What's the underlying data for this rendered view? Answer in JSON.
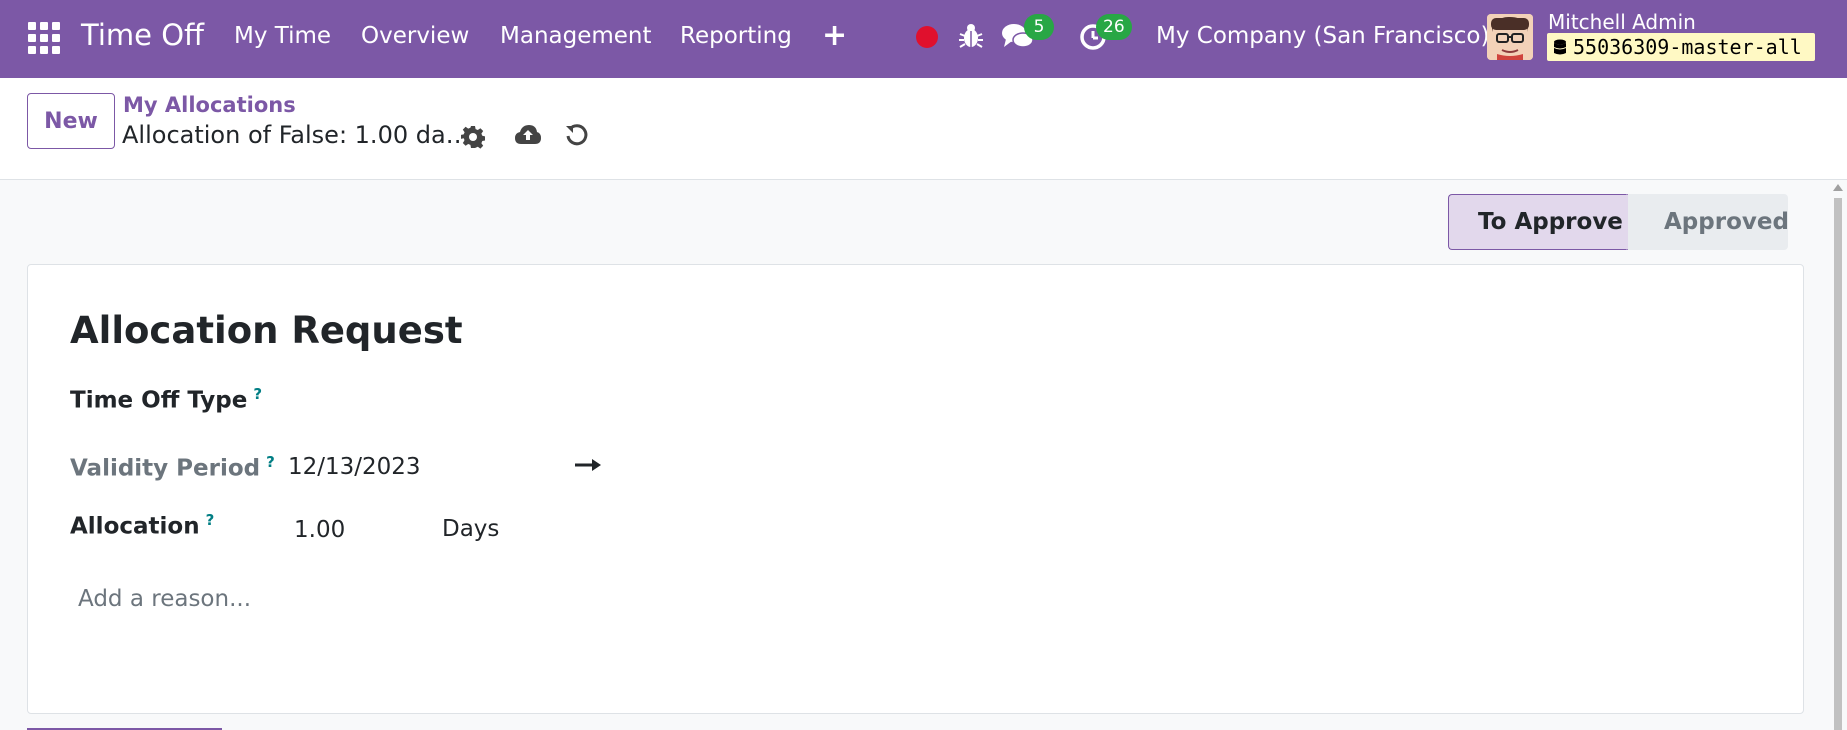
{
  "navbar": {
    "brand": "Time Off",
    "menu": [
      "My Time",
      "Overview",
      "Management",
      "Reporting"
    ],
    "plus": "+",
    "chat_count": "5",
    "activity_count": "26",
    "company": "My Company (San Francisco)",
    "user_name": "Mitchell Admin",
    "database": "55036309-master-all",
    "accent_color": "#7c58a6",
    "badge_color": "#28a745",
    "record_dot_color": "#e0102d"
  },
  "control_panel": {
    "new_label": "New",
    "breadcrumb": "My Allocations",
    "record_title": "Allocation of False: 1.00 da…",
    "icons": [
      "gear-icon",
      "cloud-upload-icon",
      "discard-icon"
    ]
  },
  "statusbar": {
    "stages": [
      "To Approve",
      "Approved"
    ],
    "active_stage": "To Approve"
  },
  "form": {
    "title": "Allocation Request",
    "time_off_type_label": "Time Off Type",
    "validity_label": "Validity Period",
    "validity_start": "12/13/2023",
    "validity_end": "",
    "allocation_label": "Allocation",
    "allocation_value": "1.00",
    "allocation_unit": "Days",
    "reason_placeholder": "Add a reason...",
    "help_mark": "?"
  }
}
